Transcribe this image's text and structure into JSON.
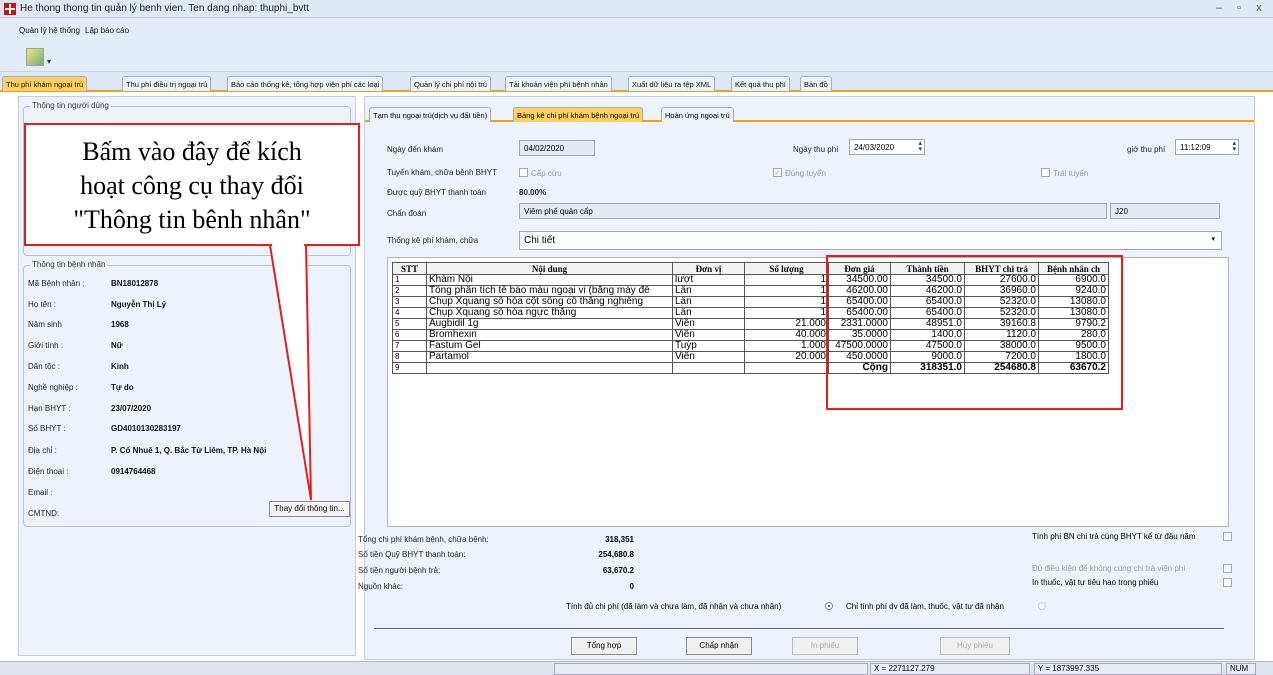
{
  "window": {
    "title": "He thong thong tin quản lý benh vien. Ten dang nhap: thuphi_bvtt"
  },
  "menu": {
    "system": "Quản lý hệ thống",
    "report": "Lập báo cáo"
  },
  "main_tabs": [
    "Thu phí khám ngoại trú",
    "Thu phí điều trị ngoại trú",
    "Báo cáo thống kê, tổng hợp viện phí các loại",
    "Quản lý chi phí nội trú",
    "Tài khoản viện phí bệnh nhân",
    "Xuất dữ liệu ra tệp XML",
    "Kết quả thu phí",
    "Bản đồ"
  ],
  "left": {
    "user_group": "Thông tin người dùng",
    "patient_group": "Thông tin bệnh nhân",
    "fields": [
      {
        "label": "Mã Bệnh nhân :",
        "value": "BN18012878"
      },
      {
        "label": "Họ tên :",
        "value": "Nguyễn Thị Lý"
      },
      {
        "label": "Năm sinh",
        "value": "1968"
      },
      {
        "label": "Giới tính :",
        "value": "Nữ"
      },
      {
        "label": "Dân tộc :",
        "value": "Kinh"
      },
      {
        "label": "Nghề nghiệp :",
        "value": "Tự do"
      },
      {
        "label": "Hạn BHYT :",
        "value": "23/07/2020"
      },
      {
        "label": "Số BHYT :",
        "value": "GD4010130283197"
      },
      {
        "label": "Địa chỉ :",
        "value": "P. Cổ Nhuế 1, Q. Bắc Từ Liêm, TP. Hà Nội"
      },
      {
        "label": "Điện thoại :",
        "value": "0914764468"
      },
      {
        "label": "Email :",
        "value": ""
      },
      {
        "label": "CMTND:",
        "value": ""
      }
    ],
    "change_button": "Thay đổi thông tin..."
  },
  "callout": {
    "line1": "Bấm vào đây để kích",
    "line2": "hoạt công cụ thay đổi",
    "line3": "\"Thông tin bênh nhân\""
  },
  "sub_tabs": [
    "Tạm thu ngoại trú(dịch vụ đất tiền)",
    "Bảng kê chi phí khám bệnh ngoại trú",
    "Hoàn ứng ngoại trú"
  ],
  "form": {
    "visit_date_label": "Ngày đến khám",
    "visit_date": "04/02/2020",
    "pay_date_label": "Ngày thu phí",
    "pay_date": "24/03/2020",
    "pay_time_label": "giờ thu phí",
    "pay_time": "11:12:09",
    "route_label": "Tuyến khám, chữa bệnh BHYT",
    "emergency": "Cấp cứu",
    "correct_route": "Đúng tuyến",
    "wrong_route": "Trái tuyến",
    "insurance_label": "Được quỹ BHYT thanh toán",
    "insurance_pct": "80.00%",
    "diagnosis_label": "Chẩn đoán",
    "diagnosis": "Viêm phế quản cấp",
    "diagnosis_code": "J20",
    "stat_label": "Thống kê phí khám, chữa",
    "stat_value": "Chi tiết"
  },
  "table": {
    "headers": [
      "STT",
      "Nội dung",
      "Đơn vị",
      "Số lượng",
      "Đơn giá",
      "Thành tiền",
      "BHYT chi trả",
      "Bệnh nhân ch"
    ],
    "rows": [
      [
        "1",
        "Khám Nội",
        "lượt",
        "1",
        "34500.00",
        "34500.0",
        "27600.0",
        "6900.0"
      ],
      [
        "2",
        "Tổng phân tích tế bào máu ngoại vi (bằng máy đế",
        "Lần",
        "1",
        "46200.00",
        "46200.0",
        "36960.0",
        "9240.0"
      ],
      [
        "3",
        "Chụp Xquang số hóa cột sống cổ thẳng nghiêng",
        "Lần",
        "1",
        "65400.00",
        "65400.0",
        "52320.0",
        "13080.0"
      ],
      [
        "4",
        "Chụp Xquang số hóa ngực thẳng",
        "Lần",
        "1",
        "65400.00",
        "65400.0",
        "52320.0",
        "13080.0"
      ],
      [
        "5",
        "Augbidil 1g",
        "Viên",
        "21.000",
        "2331.0000",
        "48951.0",
        "39160.8",
        "9790.2"
      ],
      [
        "6",
        "Bromhexin",
        "Viên",
        "40.000",
        "35.0000",
        "1400.0",
        "1120.0",
        "280.0"
      ],
      [
        "7",
        "Fastum Gel",
        "Tuýp",
        "1.000",
        "47500.0000",
        "47500.0",
        "38000.0",
        "9500.0"
      ],
      [
        "8",
        "Partamol",
        "Viên",
        "20.000",
        "450.0000",
        "9000.0",
        "7200.0",
        "1800.0"
      ],
      [
        "9",
        "",
        "",
        "",
        "Cộng",
        "318351.0",
        "254680.8",
        "63670.2"
      ]
    ]
  },
  "summary": {
    "total_label": "Tổng chi phí khám bệnh, chữa bệnh:",
    "total": "318,351",
    "fund_label": "Số tiền Quỹ BHYT thanh toán:",
    "fund": "254,680.8",
    "patient_label": "Số tiền người bệnh trả:",
    "patient": "63,670.2",
    "other_label": "Nguồn khác:",
    "other": "0",
    "opt1": "Tính phí BN chi trả cùng BHYT kể từ đầu năm",
    "opt2": "Đủ điều kiện để không cùng chi trả viện phí",
    "opt3": "In thuốc, vật tư tiêu hao trong phiếu",
    "radio1": "Tính đủ chi phí (đã làm và chưa làm, đã nhận và chưa nhận)",
    "radio2": "Chỉ tính phí dv đã làm, thuốc, vật tư đã nhận"
  },
  "buttons": {
    "sum": "Tổng hợp",
    "accept": "Chấp nhận",
    "print": "In phiếu",
    "cancel": "Hủy phiếu"
  },
  "status": {
    "x": "X = 2271127.279",
    "y": "Y = 1873997.335",
    "num": "NUM"
  }
}
